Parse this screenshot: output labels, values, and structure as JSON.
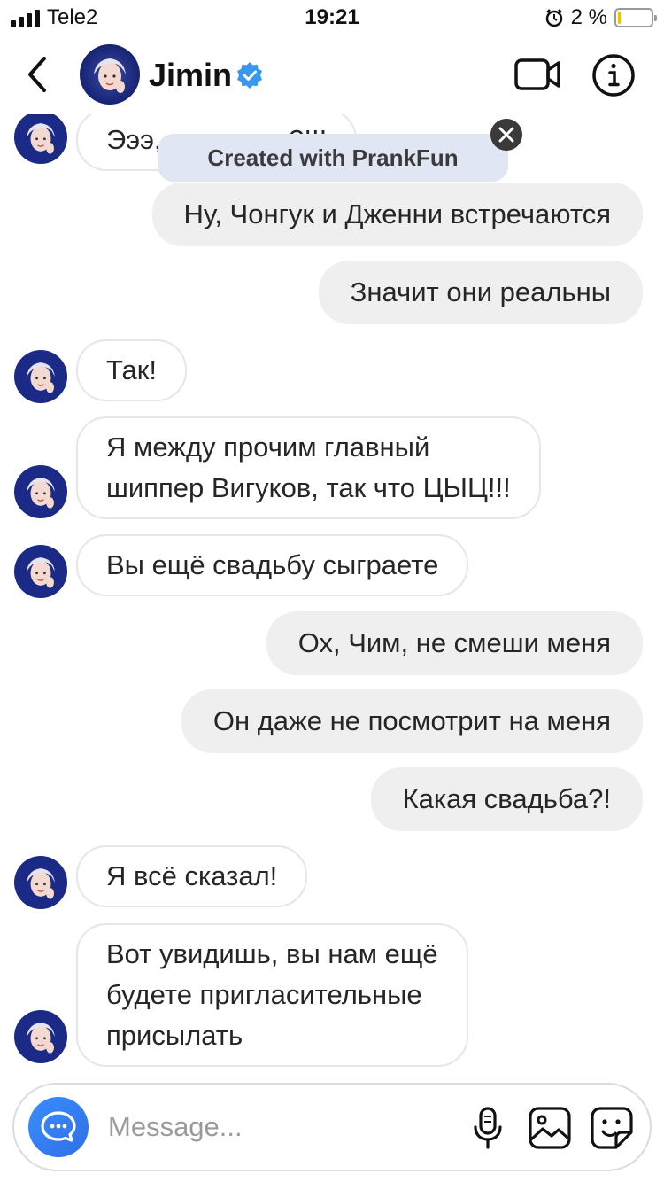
{
  "status_bar": {
    "carrier": "Tele2",
    "time": "19:21",
    "battery_percent": "2 %",
    "battery_level": 0.05,
    "alarm_icon": "alarm-clock-icon"
  },
  "header": {
    "name": "Jimin",
    "verified": true,
    "back_icon": "chevron-left-icon",
    "video_icon": "video-camera-icon",
    "info_icon": "info-icon"
  },
  "watermark": {
    "label": "Created with PrankFun",
    "close_icon": "close-icon"
  },
  "messages": [
    {
      "side": "in",
      "lines": [
        "Эээ, в смысле?!!!"
      ]
    },
    {
      "side": "out",
      "lines": [
        "Ну, Чонгук и Дженни встречаются"
      ]
    },
    {
      "side": "out",
      "lines": [
        "Значит они реальны"
      ]
    },
    {
      "side": "in",
      "lines": [
        "Так!"
      ]
    },
    {
      "side": "in",
      "lines": [
        "Я между прочим главный",
        "шиппер Вигуков, так что ЦЫЦ!!!"
      ]
    },
    {
      "side": "in",
      "lines": [
        "Вы ещё свадьбу сыграете"
      ]
    },
    {
      "side": "out",
      "lines": [
        "Ох, Чим, не смеши меня"
      ]
    },
    {
      "side": "out",
      "lines": [
        "Он даже не посмотрит на меня"
      ]
    },
    {
      "side": "out",
      "lines": [
        "Какая свадьба?!"
      ]
    },
    {
      "side": "in",
      "lines": [
        "Я всё сказал!"
      ]
    },
    {
      "side": "in",
      "lines": [
        "Вот увидишь, вы нам ещё",
        "будете пригласительные",
        "присылать"
      ]
    }
  ],
  "composer": {
    "placeholder": "Message...",
    "camera_icon": "chat-bubble-icon",
    "mic_icon": "microphone-icon",
    "gallery_icon": "image-icon",
    "sticker_icon": "sticker-icon"
  },
  "colors": {
    "accent_blue": "#3897f0",
    "verified_blue": "#3897f0",
    "outgoing_bubble": "#efefef",
    "incoming_border": "#e6e6e6",
    "watermark_bg": "#e1e6f4"
  }
}
